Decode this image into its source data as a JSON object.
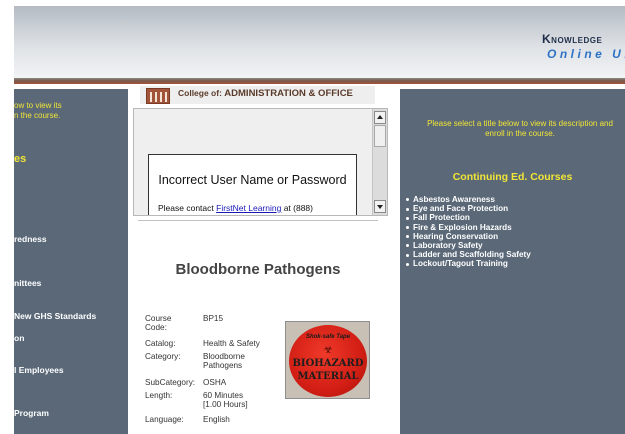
{
  "header": {
    "brand_title_start": "Knowledge",
    "brand_title_accent": "",
    "brand_subtitle": "Online Un"
  },
  "left_sidebar": {
    "intro_lines": [
      "ow to view its",
      "n the course."
    ],
    "heading": "es",
    "links": [
      {
        "label": "redness"
      },
      {
        "label": "nittees"
      },
      {
        "label": "New GHS Standards"
      },
      {
        "label": "on"
      },
      {
        "label": "l Employees"
      },
      {
        "label": "Program"
      }
    ]
  },
  "college_banner": {
    "prefix": "College of:",
    "name": "ADMINISTRATION & OFFICE"
  },
  "login_error": {
    "title": "Incorrect User Name or Password",
    "message_prefix": "Please contact ",
    "link_text": "FirstNet Learning",
    "message_suffix": " at (888)"
  },
  "course": {
    "title": "Bloodborne Pathogens",
    "details": [
      {
        "label": "Course Code:",
        "value": "BP15"
      },
      {
        "label": "Catalog:",
        "value": "Health & Safety"
      },
      {
        "label": "Category:",
        "value": "Bloodborne Pathogens"
      },
      {
        "label": "SubCategory:",
        "value": "OSHA"
      },
      {
        "label": "Length:",
        "value": "60 Minutes [1.00 Hours]"
      },
      {
        "label": "Language:",
        "value": "English"
      }
    ],
    "image": {
      "top_text": "Shok-safe Tape",
      "line1": "BIOHAZARD",
      "line2": "MATERIAL"
    }
  },
  "right_sidebar": {
    "intro": "Please select a title below to view its description and enroll in the course.",
    "heading": "Continuing Ed. Courses",
    "courses": [
      "Asbestos Awareness",
      "Eye and Face Protection",
      "Fall Protection",
      "Fire & Explosion Hazards",
      "Hearing Conservation",
      "Laboratory Safety",
      "Ladder and Scaffolding Safety",
      "Lockout/Tagout Training"
    ]
  },
  "colors": {
    "panel_bg": "#5a6878",
    "accent_yellow": "#f2e636",
    "rule_brown": "#a2543a",
    "brand_blue": "#2e72c6"
  },
  "icons": {
    "college": "college-building-icon",
    "scroll_up": "scroll-up-arrow-icon",
    "scroll_down": "scroll-down-arrow-icon",
    "biohazard": "biohazard-icon"
  }
}
